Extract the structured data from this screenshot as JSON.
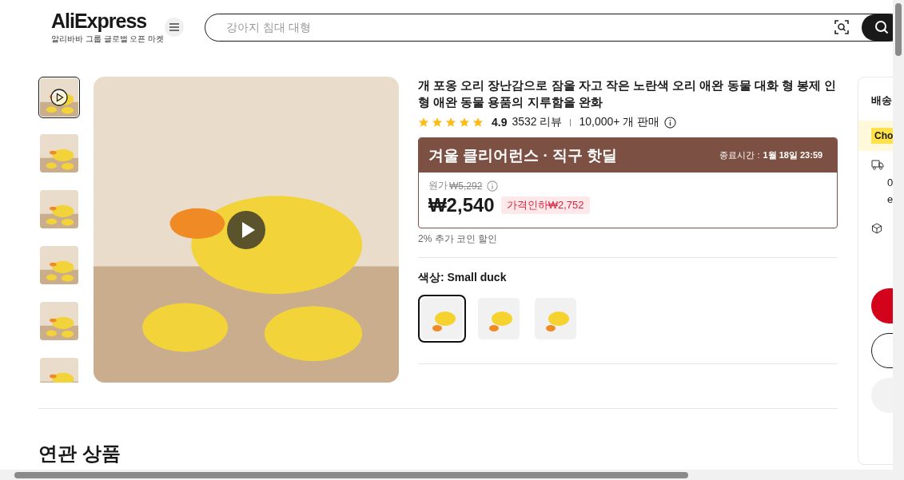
{
  "header": {
    "logo": "AliExpress",
    "tagline": "알리바바 그룹 글로벌 오픈 마켓",
    "search": {
      "placeholder": "강아지 침대 대형"
    }
  },
  "gallery": {
    "thumbnails": [
      {
        "kind": "video",
        "selected": true
      },
      {
        "kind": "image",
        "selected": false
      },
      {
        "kind": "image",
        "selected": false
      },
      {
        "kind": "image",
        "selected": false
      },
      {
        "kind": "image",
        "selected": false
      },
      {
        "kind": "image",
        "selected": false
      }
    ],
    "main": {
      "kind": "video"
    }
  },
  "product": {
    "title": "개 포옹 오리 장난감으로 잠을 자고 작은 노란색 오리 애완 동물 대화 형 봉제 인형 애완 동물 용품의 지루함을 완화",
    "stars": 5,
    "rating": "4.9",
    "reviews": "3532 리뷰",
    "sold": "10,000+ 개 판매",
    "promo": {
      "title": "겨울 클리어런스 · 직구 핫딜",
      "end_label": "종료시간 :",
      "end_time": "1월 18일 23:59"
    },
    "original_label": "원가",
    "original_price": "₩5,292",
    "price": "₩2,540",
    "discount": "가격인하₩2,752",
    "coin_note": "2% 추가 코인 할인",
    "variant_label": "색상: Small duck",
    "variants": [
      {
        "selected": true
      },
      {
        "selected": false
      },
      {
        "selected": false
      }
    ]
  },
  "side": {
    "title": "배송",
    "choice_tag": "Cho",
    "lines": [
      "0",
      "e"
    ]
  },
  "related": {
    "title": "연관 상품"
  }
}
